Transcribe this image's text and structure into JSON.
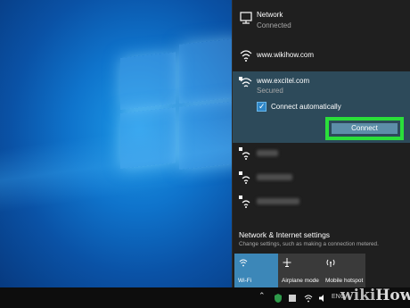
{
  "network_header": {
    "title": "Network",
    "status": "Connected"
  },
  "networks": [
    {
      "ssid": "www.wikihow.com"
    },
    {
      "ssid": "www.excitel.com",
      "status": "Secured",
      "connect_automatically": "Connect automatically",
      "connect_label": "Connect"
    }
  ],
  "settings": {
    "link": "Network & Internet settings",
    "description": "Change settings, such as making a connection metered."
  },
  "quick_actions": [
    {
      "label": "Wi-Fi",
      "active": true
    },
    {
      "label": "Airplane mode",
      "active": false
    },
    {
      "label": "Mobile hotspot",
      "active": false
    }
  ],
  "taskbar": {
    "keyboard": "ENG"
  },
  "watermark": {
    "prefix": "wiki",
    "suffix": "How"
  },
  "colors": {
    "flyout_bg": "#1f1f1f",
    "selected_bg": "#2d4a5a",
    "connect_button": "#5d8ea8",
    "highlight": "#2adf3a",
    "wifi_tile_active": "#3c87b8"
  },
  "icons": [
    "monitor-icon",
    "wifi-icon",
    "wifi-secured-icon",
    "checkbox-icon",
    "airplane-icon",
    "hotspot-icon",
    "chevron-up-icon",
    "defender-icon",
    "network-icon",
    "speaker-icon"
  ]
}
